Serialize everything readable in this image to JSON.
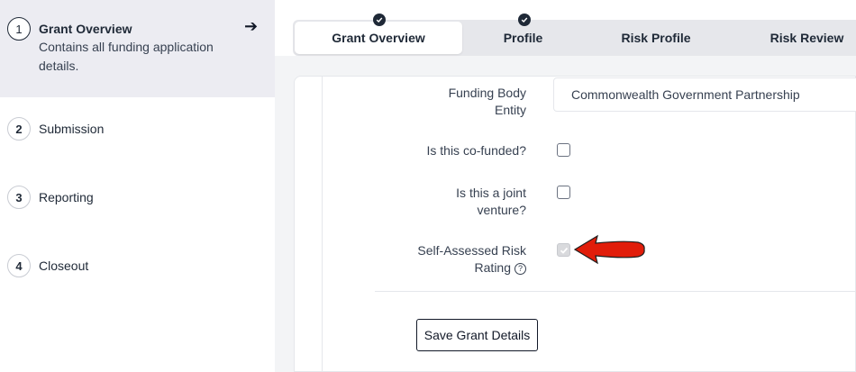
{
  "sidebar": {
    "steps": [
      {
        "number": "1",
        "title": "Grant Overview",
        "description": "Contains all funding application details."
      },
      {
        "number": "2",
        "title": "Submission"
      },
      {
        "number": "3",
        "title": "Reporting"
      },
      {
        "number": "4",
        "title": "Closeout"
      }
    ]
  },
  "tabs": [
    {
      "label": "Grant Overview",
      "completed": true,
      "active": true
    },
    {
      "label": "Profile",
      "completed": true,
      "active": false
    },
    {
      "label": "Risk Profile",
      "completed": false,
      "active": false
    },
    {
      "label": "Risk Review",
      "completed": false,
      "active": false
    }
  ],
  "form": {
    "funding_body_label": "Funding Body Entity",
    "funding_body_value": "Commonwealth Government Partnership",
    "cofunded_label": "Is this co-funded?",
    "cofunded_checked": false,
    "joint_venture_label": "Is this a joint venture?",
    "joint_venture_checked": false,
    "risk_rating_label": "Self-Assessed Risk Rating",
    "risk_rating_checked": true,
    "risk_rating_disabled": true,
    "help_icon_glyph": "?",
    "save_label": "Save Grant Details"
  },
  "colors": {
    "annotation_arrow": "#e11d0a",
    "active_step_bg": "#ececf2",
    "tabbar_bg": "#e6e7eb"
  }
}
